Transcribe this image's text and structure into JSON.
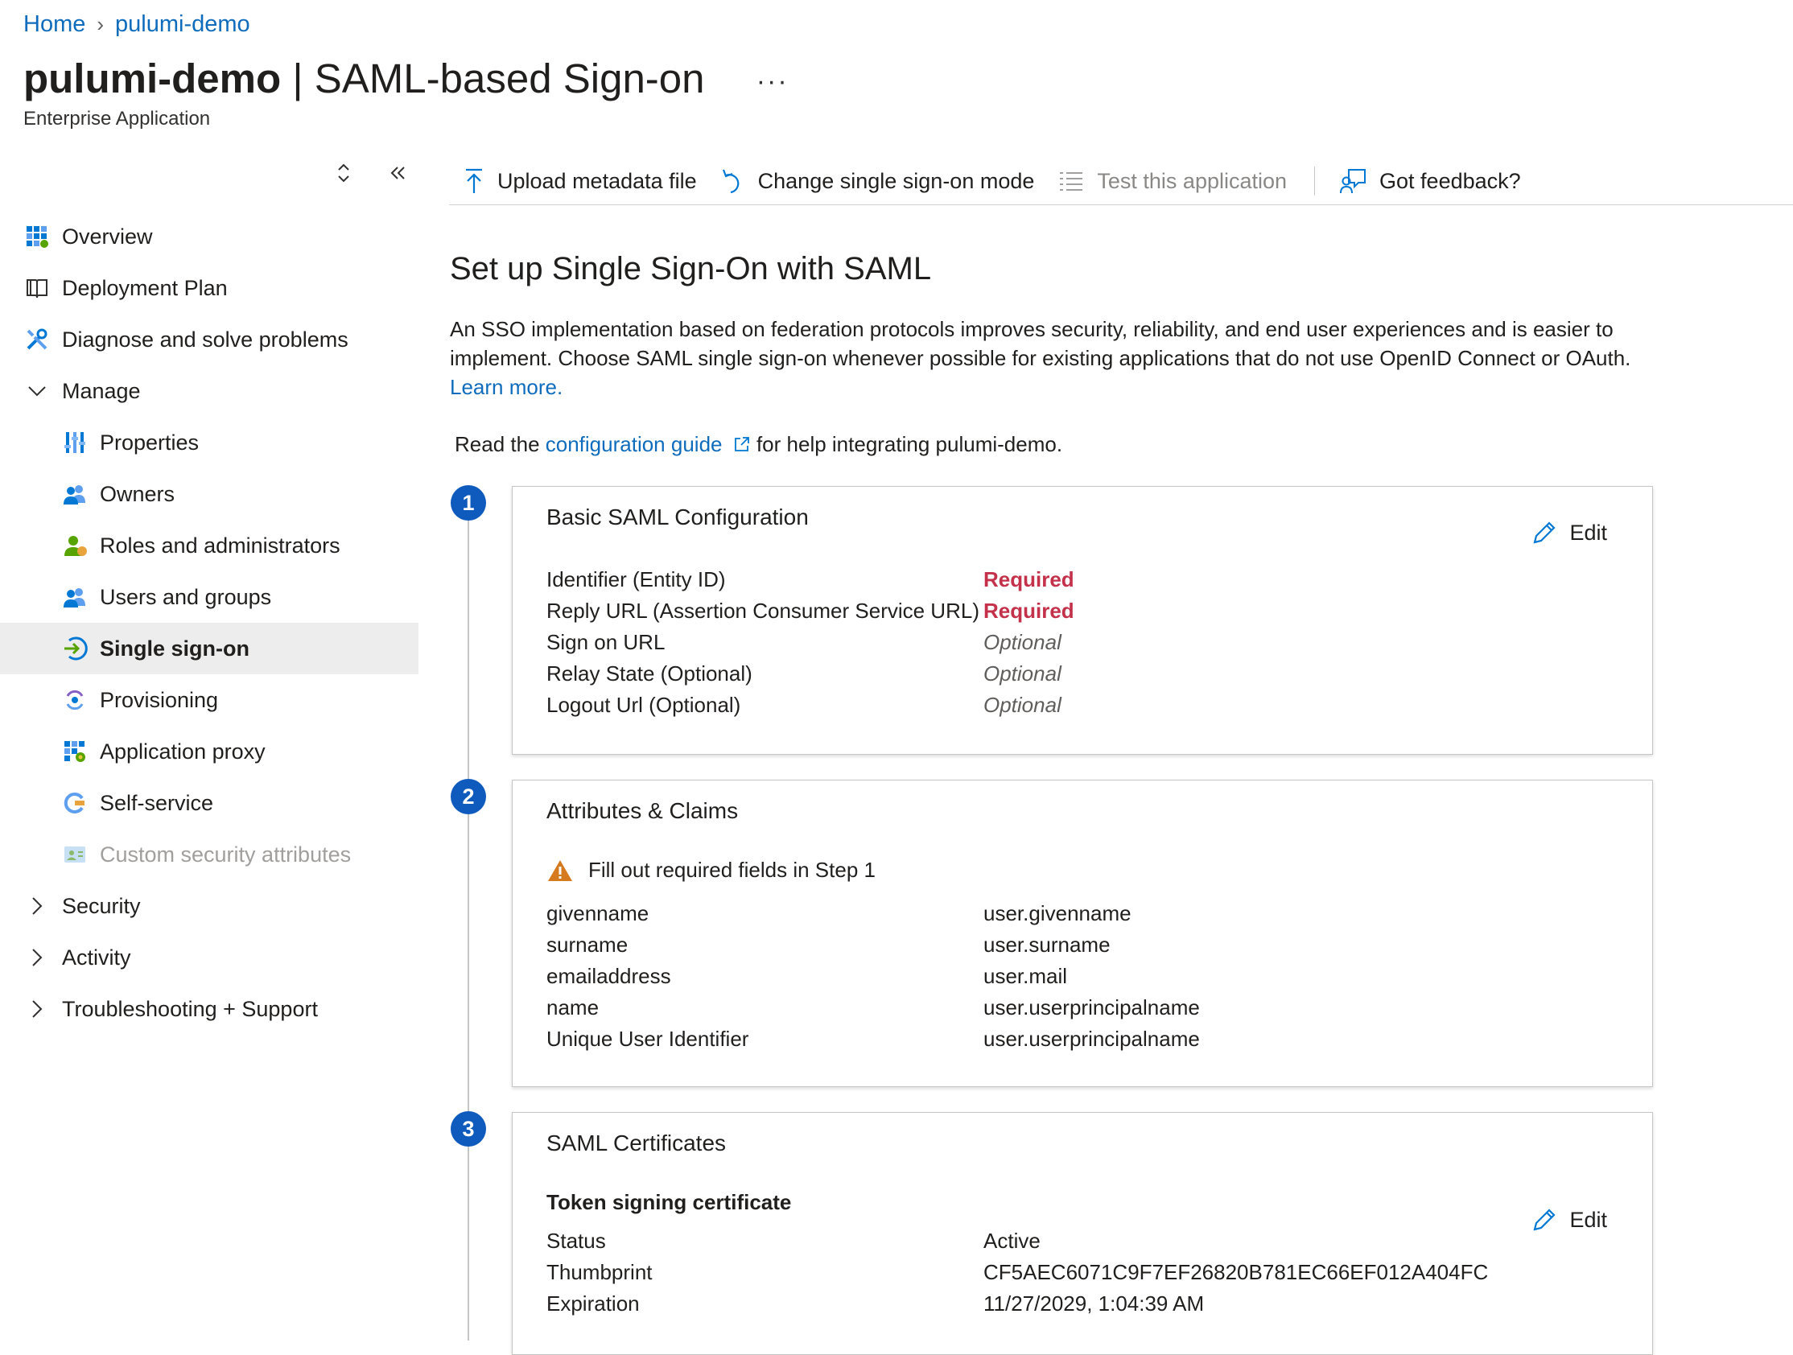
{
  "breadcrumb": {
    "home": "Home",
    "app": "pulumi-demo"
  },
  "header": {
    "title_bold": "pulumi-demo",
    "title_rest": "| SAML-based Sign-on",
    "more": "···",
    "subtitle": "Enterprise Application"
  },
  "sidebar": {
    "items": [
      {
        "label": "Overview",
        "icon": "overview-icon"
      },
      {
        "label": "Deployment Plan",
        "icon": "book-icon"
      },
      {
        "label": "Diagnose and solve problems",
        "icon": "wrench-icon"
      },
      {
        "label": "Manage",
        "icon": "chevron-down-icon"
      },
      {
        "label": "Properties",
        "icon": "properties-icon"
      },
      {
        "label": "Owners",
        "icon": "owners-icon"
      },
      {
        "label": "Roles and administrators",
        "icon": "roles-icon"
      },
      {
        "label": "Users and groups",
        "icon": "users-icon"
      },
      {
        "label": "Single sign-on",
        "icon": "sso-icon",
        "active": true
      },
      {
        "label": "Provisioning",
        "icon": "provisioning-icon"
      },
      {
        "label": "Application proxy",
        "icon": "app-proxy-icon"
      },
      {
        "label": "Self-service",
        "icon": "self-service-icon"
      },
      {
        "label": "Custom security attributes",
        "icon": "custom-attributes-icon",
        "disabled": true
      },
      {
        "label": "Security",
        "icon": "chevron-right-icon"
      },
      {
        "label": "Activity",
        "icon": "chevron-right-icon"
      },
      {
        "label": "Troubleshooting + Support",
        "icon": "chevron-right-icon"
      }
    ]
  },
  "toolbar": {
    "upload": "Upload metadata file",
    "change_mode": "Change single sign-on mode",
    "test": "Test this application",
    "feedback": "Got feedback?"
  },
  "main": {
    "heading": "Set up Single Sign-On with SAML",
    "description": "An SSO implementation based on federation protocols improves security, reliability, and end user experiences and is easier to implement. Choose SAML single sign-on whenever possible for existing applications that do not use OpenID Connect or OAuth.",
    "learn_more": "Learn more.",
    "guide_prefix": "Read the",
    "guide_link": "configuration guide",
    "guide_suffix": "for help integrating pulumi-demo."
  },
  "steps": [
    {
      "number": "1",
      "title": "Basic SAML Configuration",
      "edit": "Edit",
      "rows": [
        {
          "key": "Identifier (Entity ID)",
          "value": "Required"
        },
        {
          "key": "Reply URL (Assertion Consumer Service URL)",
          "value": "Required"
        },
        {
          "key": "Sign on URL",
          "value": "Optional"
        },
        {
          "key": "Relay State (Optional)",
          "value": "Optional"
        },
        {
          "key": "Logout Url (Optional)",
          "value": "Optional"
        }
      ]
    },
    {
      "number": "2",
      "title": "Attributes & Claims",
      "warning": "Fill out required fields in Step 1",
      "rows": [
        {
          "key": "givenname",
          "value": "user.givenname"
        },
        {
          "key": "surname",
          "value": "user.surname"
        },
        {
          "key": "emailaddress",
          "value": "user.mail"
        },
        {
          "key": "name",
          "value": "user.userprincipalname"
        },
        {
          "key": "Unique User Identifier",
          "value": "user.userprincipalname"
        }
      ]
    },
    {
      "number": "3",
      "title": "SAML Certificates",
      "subheading": "Token signing certificate",
      "edit": "Edit",
      "rows": [
        {
          "key": "Status",
          "value": "Active"
        },
        {
          "key": "Thumbprint",
          "value": "CF5AEC6071C9F7EF26820B781EC66EF012A404FC"
        },
        {
          "key": "Expiration",
          "value": "11/27/2029, 1:04:39 AM"
        }
      ]
    }
  ],
  "colors": {
    "accent": "#0f6cbd",
    "required": "#c4314b",
    "step_circle": "#0f5bbd",
    "warning": "#d67a1f"
  }
}
